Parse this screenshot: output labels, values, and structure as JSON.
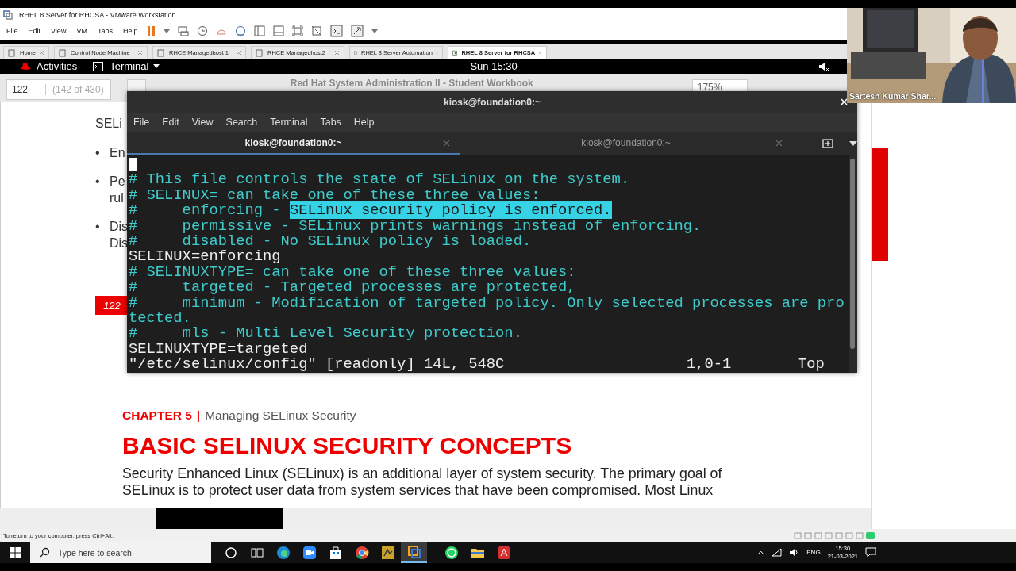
{
  "vmware": {
    "title": "RHEL 8 Server for RHCSA - VMware Workstation",
    "menu": [
      "File",
      "Edit",
      "View",
      "VM",
      "Tabs",
      "Help"
    ],
    "tabs": [
      {
        "label": "Home",
        "selected": false
      },
      {
        "label": "Control Node Machine",
        "selected": false
      },
      {
        "label": "RHCE Managedhost 1",
        "selected": false
      },
      {
        "label": "RHCE Managedhost2",
        "selected": false
      },
      {
        "label": "RHEL 8 Server Automation",
        "selected": false
      },
      {
        "label": "RHEL 8 Server for RHCSA",
        "selected": true
      }
    ],
    "status": "To return to your computer, press Ctrl+Alt."
  },
  "gnome_bar": {
    "activities": "Activities",
    "app": "Terminal",
    "clock": "Sun 15:30"
  },
  "viewer": {
    "page": "122",
    "page_count": "(142 of 430)",
    "title": "Red Hat System Administration II - Student Workbook",
    "zoom": "175%",
    "fragments": [
      {
        "kind": "title",
        "text": "SELi"
      },
      {
        "kind": "bullet",
        "bullet": "•",
        "text": "En"
      },
      {
        "kind": "bullet",
        "bullet": "•",
        "text": "Pe"
      },
      {
        "kind": "cont",
        "text": "rul"
      },
      {
        "kind": "bullet",
        "bullet": "•",
        "text": "Dis"
      },
      {
        "kind": "cont",
        "text": "Dis"
      }
    ],
    "page_badge": "122",
    "chapter_label": "CHAPTER 5",
    "chapter_sep": "|",
    "chapter_title": "Managing SELinux Security",
    "heading": "BASIC SELINUX SECURITY CONCEPTS",
    "paragraph": "Security Enhanced Linux (SELinux) is an additional layer of system security. The primary goal of SELinux is to protect user data from system services that have been compromised. Most Linux"
  },
  "terminal": {
    "title": "kiosk@foundation0:~",
    "menu": [
      "File",
      "Edit",
      "View",
      "Search",
      "Terminal",
      "Tabs",
      "Help"
    ],
    "tabs": [
      {
        "label": "kiosk@foundation0:~",
        "selected": true
      },
      {
        "label": "kiosk@foundation0:~",
        "selected": false
      }
    ],
    "lines": [
      {
        "kind": "cursor"
      },
      {
        "kind": "comment",
        "text": "# This file controls the state of SELinux on the system."
      },
      {
        "kind": "comment",
        "text": "# SELINUX= can take one of these three values:"
      },
      {
        "kind": "comment",
        "text": "#     enforcing - ",
        "highlight": "SELinux security policy is enforced."
      },
      {
        "kind": "comment",
        "text": "#     permissive - SELinux prints warnings instead of enforcing."
      },
      {
        "kind": "comment",
        "text": "#     disabled - No SELinux policy is loaded."
      },
      {
        "kind": "setting",
        "text": "SELINUX=enforcing"
      },
      {
        "kind": "comment",
        "text": "# SELINUXTYPE= can take one of these three values:"
      },
      {
        "kind": "comment",
        "text": "#     targeted - Targeted processes are protected,"
      },
      {
        "kind": "comment",
        "text": "#     minimum - Modification of targeted policy. Only selected processes are pro"
      },
      {
        "kind": "comment",
        "text": "tected."
      },
      {
        "kind": "comment",
        "text": "#     mls - Multi Level Security protection."
      },
      {
        "kind": "setting",
        "text": "SELINUXTYPE=targeted"
      }
    ],
    "status": {
      "file": "\"/etc/selinux/config\" [readonly] 14L, 548C",
      "position": "1,0-1",
      "scroll": "Top"
    }
  },
  "webcam": {
    "kind": "picture",
    "name": "Sartesh Kumar Shar..."
  },
  "taskbar": {
    "search_placeholder": "Type here to search",
    "language": "ENG",
    "time": "15:30",
    "date": "21-03-2021"
  }
}
